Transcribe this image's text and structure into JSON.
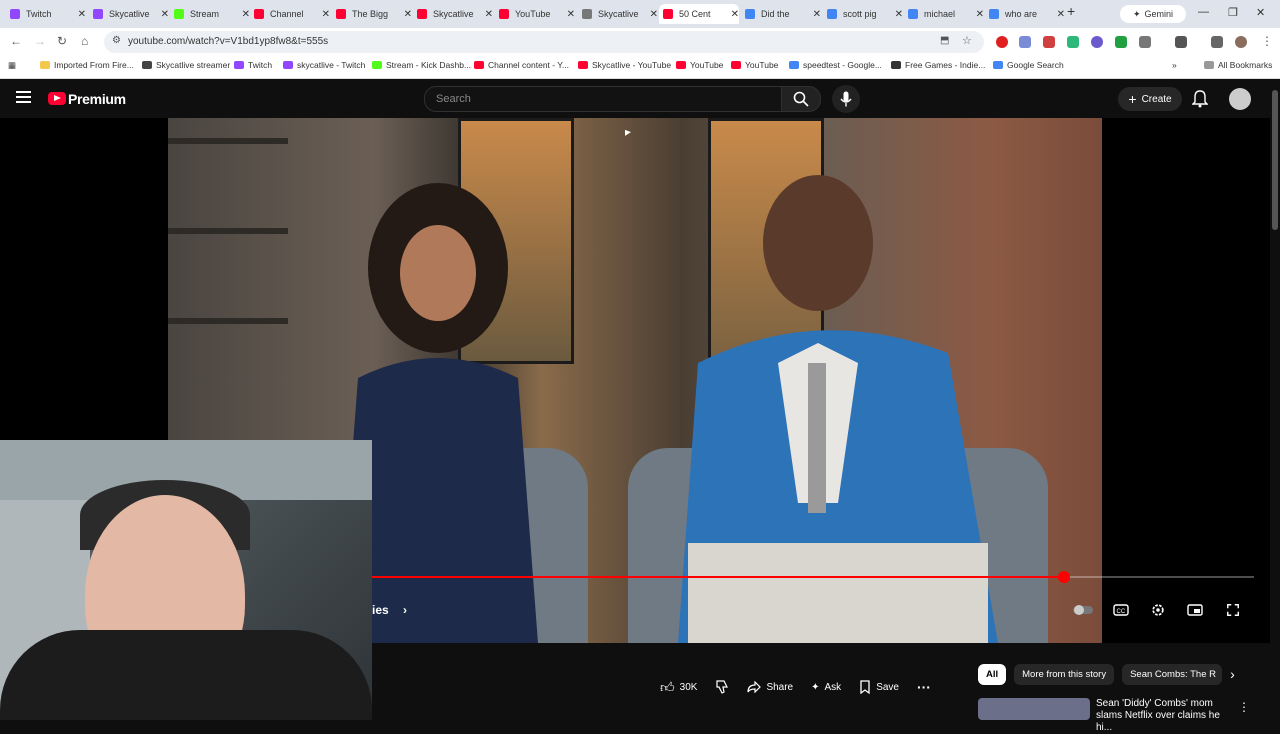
{
  "browser": {
    "tabs": [
      {
        "label": "Twitch",
        "color": "#9146ff"
      },
      {
        "label": "Skycatlive",
        "color": "#9146ff"
      },
      {
        "label": "Stream",
        "color": "#53fc18"
      },
      {
        "label": "Channel",
        "color": "#ff0033"
      },
      {
        "label": "The Bigg",
        "color": "#ff0033"
      },
      {
        "label": "Skycatlive",
        "color": "#ff0033"
      },
      {
        "label": "YouTube",
        "color": "#ff0033"
      },
      {
        "label": "Skycatlive",
        "color": "#777777"
      },
      {
        "label": "50 Cent",
        "color": "#ff0033"
      },
      {
        "label": "Did the",
        "color": "#4285f4"
      },
      {
        "label": "scott pig",
        "color": "#4285f4"
      },
      {
        "label": "michael",
        "color": "#4285f4"
      },
      {
        "label": "who are",
        "color": "#4285f4"
      }
    ],
    "new_tab": "+",
    "gemini_label": "Gemini",
    "url": "youtube.com/watch?v=V1bd1yp8fw8&t=555s",
    "bookmarks": [
      {
        "label": "Imported From Fire...",
        "color": "#f2c94c"
      },
      {
        "label": "Skycatlive streamer",
        "color": "#444444"
      },
      {
        "label": "Twitch",
        "color": "#9146ff"
      },
      {
        "label": "skycatlive - Twitch",
        "color": "#9146ff"
      },
      {
        "label": "Stream - Kick Dashb...",
        "color": "#53fc18"
      },
      {
        "label": "Channel content - Y...",
        "color": "#ff0033"
      },
      {
        "label": "Skycatlive - YouTube",
        "color": "#ff0033"
      },
      {
        "label": "YouTube",
        "color": "#ff0033"
      },
      {
        "label": "YouTube",
        "color": "#ff0033"
      },
      {
        "label": "speedtest - Google...",
        "color": "#4285f4"
      },
      {
        "label": "Free Games - Indie...",
        "color": "#333333"
      },
      {
        "label": "Google Search",
        "color": "#4285f4"
      }
    ],
    "bookmarks_overflow": "»",
    "all_bookmarks": "All Bookmarks"
  },
  "youtube": {
    "logo_text": "Premium",
    "search_placeholder": "Search",
    "create_label": "Create",
    "chapter_label": "ies",
    "progress": 0.785,
    "actions": {
      "like_count": "30K",
      "share": "Share",
      "ask": "Ask",
      "save": "Save"
    },
    "chips": [
      "All",
      "More from this story",
      "Sean Combs: The R"
    ],
    "recommendation_title": "Sean 'Diddy' Combs' mom slams Netflix over claims he hi..."
  },
  "colors": {
    "accent_red": "#ff0000",
    "page_bg": "#0f0f0f"
  }
}
